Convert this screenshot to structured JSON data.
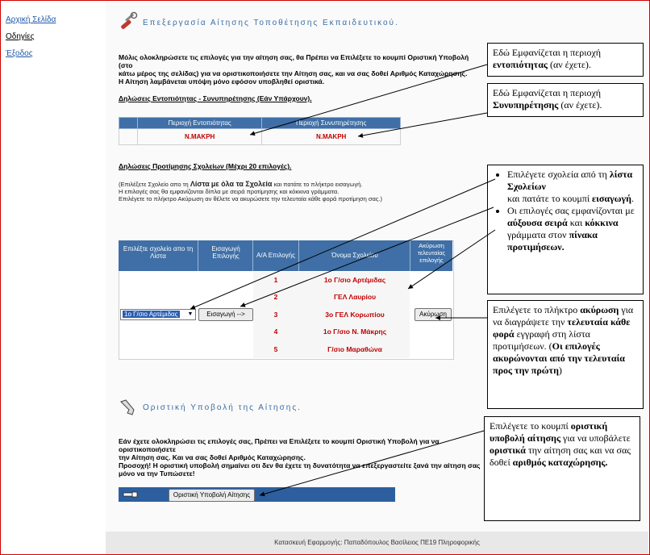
{
  "nav": {
    "home": "Αρχική Σελίδα",
    "help": "Οδηγίες",
    "exit": "Έξοδος"
  },
  "header": {
    "title": "Επεξεργασία Αίτησης Τοποθέτησης Εκπαιδευτικού."
  },
  "intro": {
    "line1": "Μόλις ολοκληρώσετε τις επιλογές για την αίτηση σας, θα Πρέπει να Επιλέξετε το κουμπί Οριστική Υποβολή (στο",
    "line2": "κάτω μέρος της σελίδας) για να οριστικοποιήσετε την Αίτηση σας, και να σας δοθεί Αριθμός Καταχώρησης.",
    "line3": "Η Αίτηση λαμβάνεται υπόψη μόνο εφόσον υποβληθεί οριστικά."
  },
  "declarations": {
    "title": "Δηλώσεις Εντοπιότητας - Συνυπηρέτησης (Εάν Υπάρχουν).",
    "col1": "Περιοχή Εντοπιότητας",
    "col2": "Περιοχή Συνυπηρέτησης",
    "val1": "Ν.ΜΑΚΡΗ",
    "val2": "Ν.ΜΑΚΡΗ"
  },
  "preferences": {
    "title": "Δηλώσεις Προτίμησης Σχολείων (Μέχρι 20 επιλογές).",
    "help1a": "(Επιλέξετε Σχολείο απο τη",
    "help1b": "Λίστα",
    "help1c": "με όλα τα Σχολεία",
    "help1d": "και πατάτε το πλήκτρο εισαγωγή.",
    "help2": "Η επιλογές σας θα εμφανίζονται δίπλα με σειρά προτίμησης και κόκκινα γράμματα.",
    "help3": "Επιλέγετε το πλήκτρο Ακύρωση αν θέλετε να ακυρώσετε την τελευταία κάθε φορά προτίμηση σας.)",
    "headers": [
      "Επιλέξτε σχολείο απο τη Λίστα",
      "Εισαγωγή Επιλογής",
      "Α/Α Επιλογής",
      "Όνομα Σχολείου",
      "Ακύρωση τελευταίας επιλογής"
    ],
    "rows": [
      {
        "num": "1",
        "school": "1ο Γ/σιο Αρτέμιδας"
      },
      {
        "num": "2",
        "school": "ΓΕΛ Λαυρίου"
      },
      {
        "num": "3",
        "school": "3ο ΓΕΛ Κορωπίου"
      },
      {
        "num": "4",
        "school": "1ο Γ/σιο Ν. Μάκρης"
      },
      {
        "num": "5",
        "school": "Γ/σιο Μαραθώνα"
      }
    ],
    "select_value": "1ο Γ/σιο Αρτέμιδας",
    "insert_button": "Εισαγωγή -->",
    "cancel_button": "Ακύρωση"
  },
  "submit": {
    "title": "Οριστική Υποβολή της Αίτησης.",
    "line1": "Εάν έχετε ολοκληρώσει τις επιλογές σας, Πρέπει να Επιλέξετε το κουμπί Οριστική Υποβολή για να οριστικοποιήσετε",
    "line2": "την Αίτηση σας. Και να σας δοθεί Αριθμός Καταχώρησης.",
    "line3": "Προσοχή! Η οριστική υποβολή σημαίνει οτι δεν θα έχετε τη δυνατότητα να επεξεργαστείτε ξανά την αίτηση σας",
    "line4": "μόνο να την Τυπώσετε!",
    "button": "Οριστική Υποβολή Αίτησης"
  },
  "footer": "Κατασκευή Εφαρμογής: Παπαδόπουλος Βασίλειος ΠΕ19 Πληροφορικής",
  "callouts": {
    "c1a": "Εδώ Εμφανίζεται η περιοχή",
    "c1b": "εντοπιότητας",
    "c1c": "(αν έχετε).",
    "c2a": "Εδώ Εμφανίζεται η περιοχή",
    "c2b": "Συνυπηρέτησης",
    "c2c": "(αν έχετε).",
    "c3_1a": "Επιλέγετε σχολεία από τη",
    "c3_1b": "λίστα",
    "c3_1c": "Σχολείων",
    "c3_2a": "και πατάτε το κουμπί",
    "c3_2b": "εισαγωγή",
    "c3_3a": "Οι επιλογές σας εμφανίζονται με",
    "c3_3b": "αύξουσα σειρά",
    "c3_3c": "και",
    "c3_3d": "κόκκινα",
    "c3_3e": "γράμματα στον",
    "c3_3f": "πίνακα προτιμήσεων.",
    "c4a": "Επιλέγετε το πλήκτρο",
    "c4b": "ακύρωση",
    "c4c": "για να διαγράψετε την",
    "c4d": "τελευταία κάθε φορά",
    "c4e": "εγγραφή στη λίστα προτιμήσεων. (",
    "c4f": "Οι επιλογές ακυρώνονται από την τελευταία προς την πρώτη",
    "c4g": ")",
    "c5a": "Επιλέγετε το κουμπί",
    "c5b": "οριστική υποβολή αίτησης",
    "c5c": "για να υποβάλετε",
    "c5d": "οριστικά",
    "c5e": "την αίτηση σας και να σας δοθεί",
    "c5f": "αριθμός καταχώρησης."
  },
  "icons": {
    "header": "wrench-icon",
    "submit": "hand-pointer-icon"
  },
  "colors": {
    "table_header": "#3f6fa6",
    "selected_red": "#c00000",
    "link_blue": "#1e5aa8",
    "frame_red": "#d00000"
  }
}
